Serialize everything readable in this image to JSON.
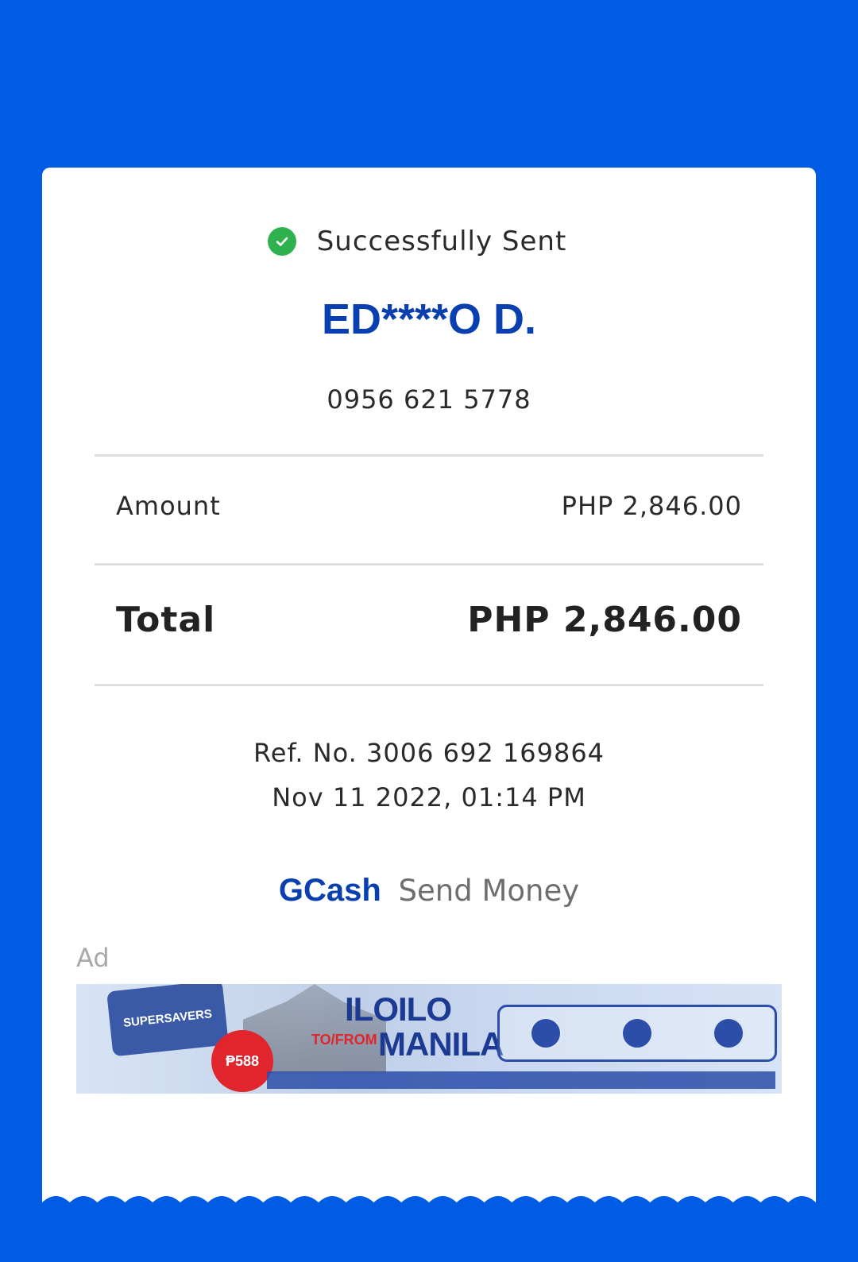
{
  "receipt": {
    "status_text": "Successfully Sent",
    "recipient_name": "ED****O D.",
    "recipient_number": "0956 621 5778",
    "amount_label": "Amount",
    "amount_value": "PHP 2,846.00",
    "total_label": "Total",
    "total_value": "PHP 2,846.00",
    "reference": "Ref. No. 3006 692 169864",
    "datetime": "Nov 11 2022, 01:14 PM",
    "brand_name": "GCash",
    "service_name": "Send Money"
  },
  "ad": {
    "label": "Ad",
    "banner": {
      "tag_text": "SUPERSAVERS",
      "price_text": "₱588",
      "title_top": "ILOILO",
      "title_connector": "TO/FROM",
      "title_bottom": "MANILA"
    }
  },
  "colors": {
    "background": "#005ce5",
    "card": "#ffffff",
    "success_green": "#2fb14f",
    "brand_blue": "#0a3fb0",
    "divider": "#dedede"
  },
  "icons": {
    "status": "check-circle-icon"
  }
}
